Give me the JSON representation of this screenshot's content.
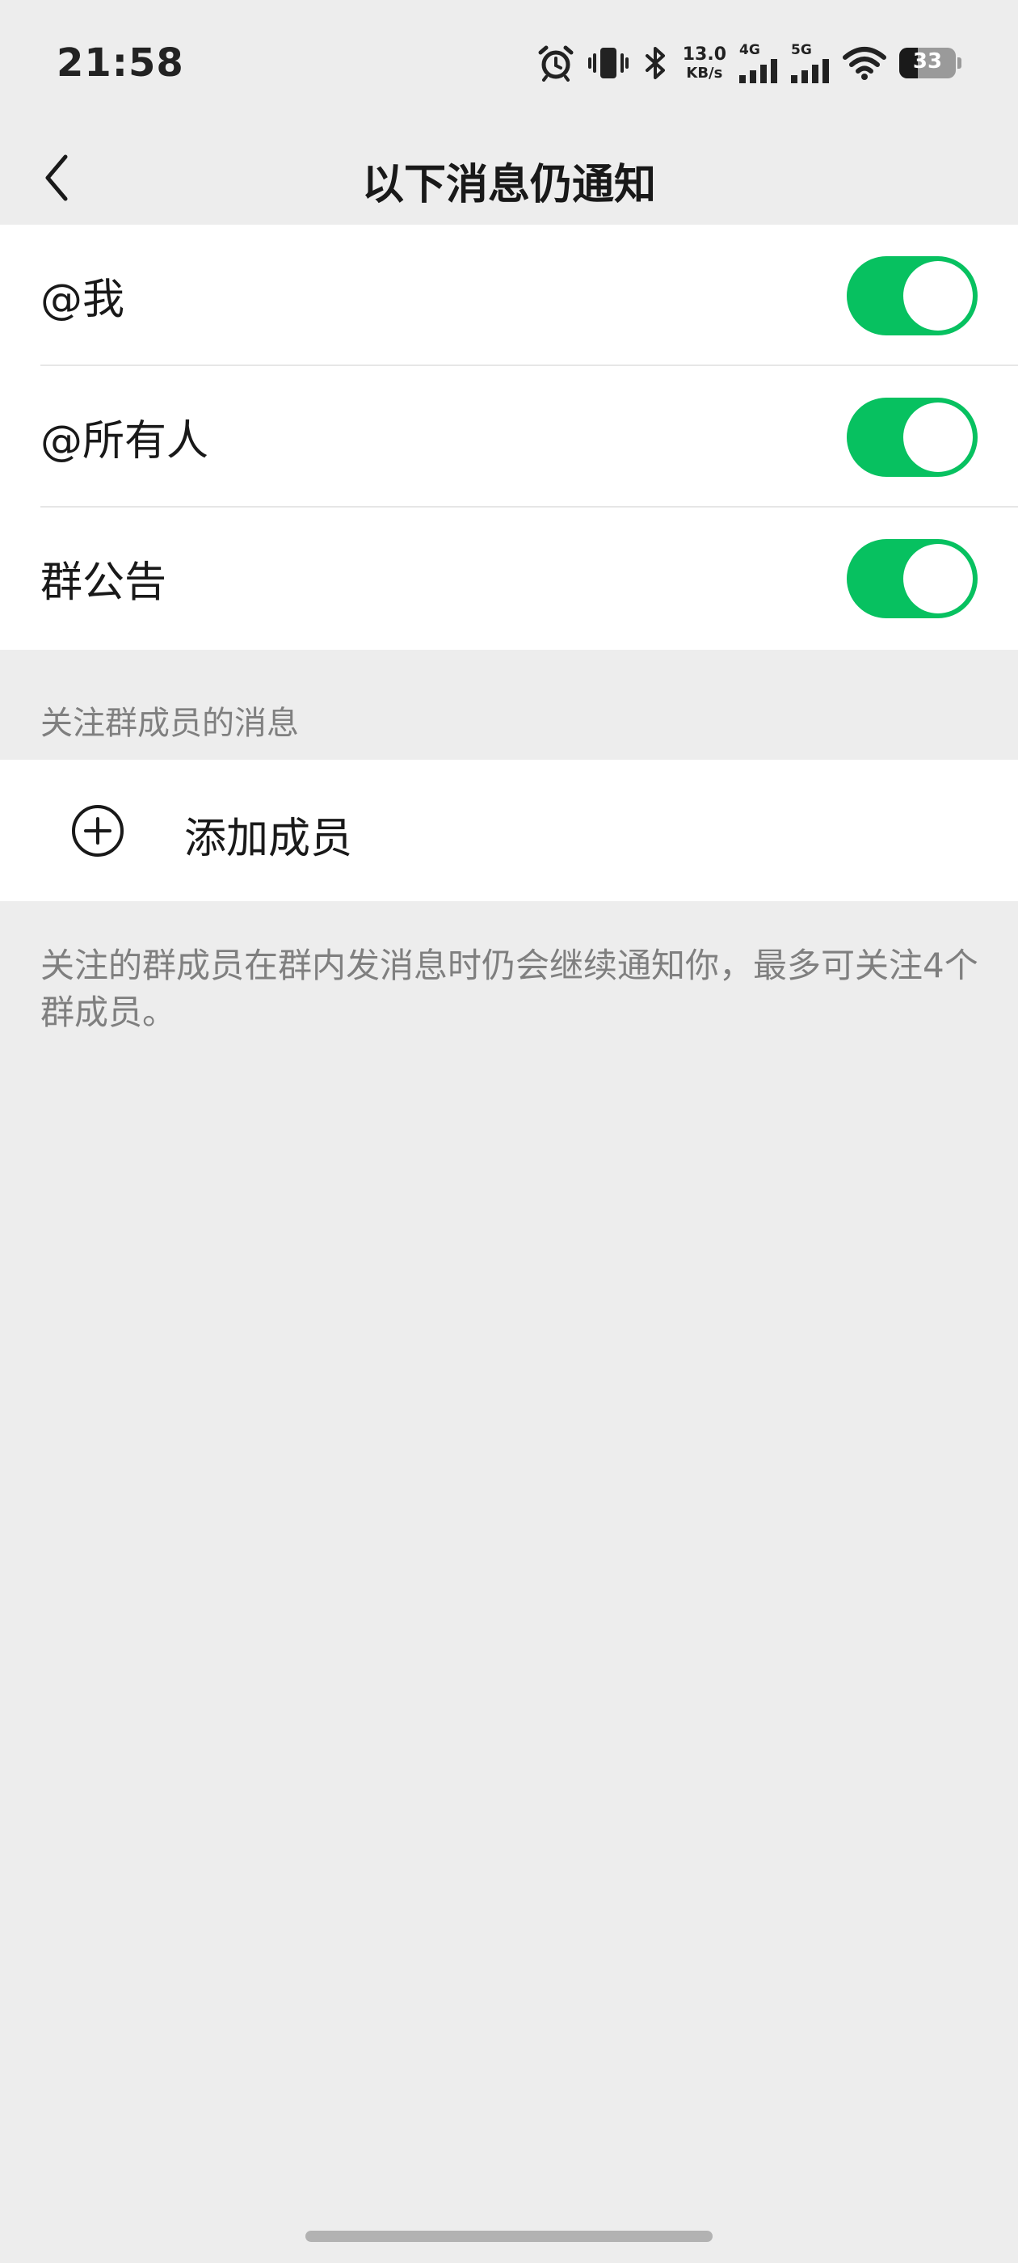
{
  "status_bar": {
    "time": "21:58",
    "network_speed_value": "13.0",
    "network_speed_unit": "KB/s",
    "sim1_label": "4G",
    "sim2_label": "5G",
    "battery_level": "33",
    "battery_fraction": 0.33
  },
  "nav": {
    "title": "以下消息仍通知"
  },
  "toggles": [
    {
      "label": "@我",
      "on": true
    },
    {
      "label": "@所有人",
      "on": true
    },
    {
      "label": "群公告",
      "on": true
    }
  ],
  "members_section": {
    "header": "关注群成员的消息",
    "add_label": "添加成员",
    "footnote": "关注的群成员在群内发消息时仍会继续通知你，最多可关注4个群成员。"
  },
  "colors": {
    "accent": "#07c160",
    "background": "#ededed",
    "card": "#ffffff",
    "secondary_text": "#7f7f7f"
  },
  "icons": [
    "alarm-icon",
    "vibrate-icon",
    "bluetooth-icon",
    "signal-icon",
    "wifi-icon",
    "battery-icon",
    "back-arrow-icon",
    "add-circle-icon"
  ]
}
